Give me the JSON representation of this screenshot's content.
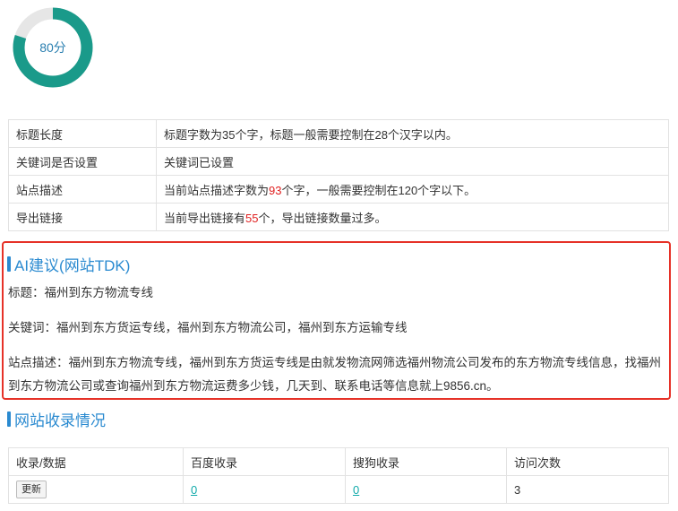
{
  "score": {
    "label": "80分",
    "value": 80,
    "ring_color": "#1a9a8a",
    "track_color": "#e6e6e6"
  },
  "seo_table": [
    {
      "key": "标题长度",
      "value": "标题字数为35个字，标题一般需要控制在28个汉字以内。"
    },
    {
      "key": "关键词是否设置",
      "value": "关键词已设置"
    },
    {
      "key": "站点描述",
      "pre": "当前站点描述字数为",
      "num": "93",
      "post": "个字，一般需要控制在120个字以下。"
    },
    {
      "key": "导出链接",
      "pre": "当前导出链接有",
      "num": "55",
      "post": "个，导出链接数量过多。"
    }
  ],
  "ai": {
    "title": "AI建议(网站TDK)",
    "title_line": "标题：福州到东方物流专线",
    "keywords_line": "关键词：福州到东方货运专线，福州到东方物流公司，福州到东方运输专线",
    "desc_line": "站点描述：福州到东方物流专线，福州到东方货运专线是由就发物流网筛选福州物流公司发布的东方物流专线信息，找福州到东方物流公司或查询福州到东方物流运费多少钱，几天到、联系电话等信息就上9856.cn。"
  },
  "index_section": {
    "title": "网站收录情况",
    "headers": [
      "收录/数据",
      "百度收录",
      "搜狗收录",
      "访问次数"
    ],
    "refresh_label": "更新",
    "baidu": "0",
    "sogou": "0",
    "visits": "3"
  }
}
